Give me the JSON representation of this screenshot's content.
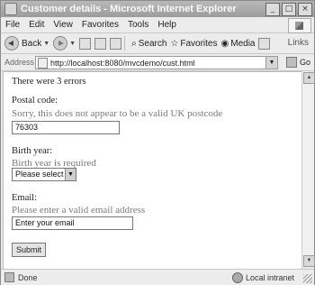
{
  "window": {
    "title": "Customer details - Microsoft Internet Explorer"
  },
  "menu": [
    "File",
    "Edit",
    "View",
    "Favorites",
    "Tools",
    "Help"
  ],
  "toolbar": {
    "back": "Back",
    "search": "Search",
    "favorites": "Favorites",
    "media": "Media",
    "links": "Links"
  },
  "address": {
    "label": "Address",
    "url": "http://localhost:8080/mvcdemo/cust.html",
    "go": "Go"
  },
  "form": {
    "error_count": "There were 3 errors",
    "postal_label": "Postal code:",
    "postal_error": "Sorry, this does not appear to be a valid UK postcode",
    "postal_value": "76303",
    "birth_label": "Birth year:",
    "birth_error": "Birth year is required",
    "birth_select": "Please select",
    "email_label": "Email:",
    "email_error": "Please enter a valid email address",
    "email_value": "Enter your email",
    "submit": "Submit"
  },
  "status": {
    "left": "Done",
    "zone": "Local intranet"
  }
}
